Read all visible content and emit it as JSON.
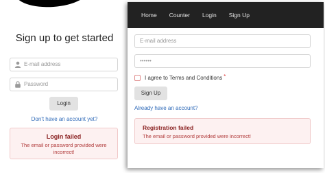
{
  "login_page": {
    "title": "Sign up to get started",
    "email_placeholder": "E-mail address",
    "password_placeholder": "Password",
    "login_button": "Login",
    "signup_link": "Don't have an account yet?",
    "alert": {
      "title": "Login failed",
      "message": "The email or password provided were incorrect!"
    }
  },
  "register_window": {
    "nav": [
      "Home",
      "Counter",
      "Login",
      "Sign Up"
    ],
    "email_placeholder": "E-mail address",
    "password_value": "••••••",
    "terms_label": "I agree to Terms and Conditions",
    "required_mark": "*",
    "signup_button": "Sign Up",
    "login_link": "Already have an account?",
    "alert": {
      "title": "Registration failed",
      "message": "The email or password provided were incorrect!"
    }
  },
  "icons": {
    "user": "user-icon",
    "lock": "lock-icon",
    "blob": "brand-blob"
  },
  "colors": {
    "nav_bg": "#222222",
    "link": "#2f6ab8",
    "error_bg": "#fdf1f1",
    "error_border": "#f0c8c8",
    "error_title": "#8a2222",
    "error_text": "#b03a3a"
  }
}
